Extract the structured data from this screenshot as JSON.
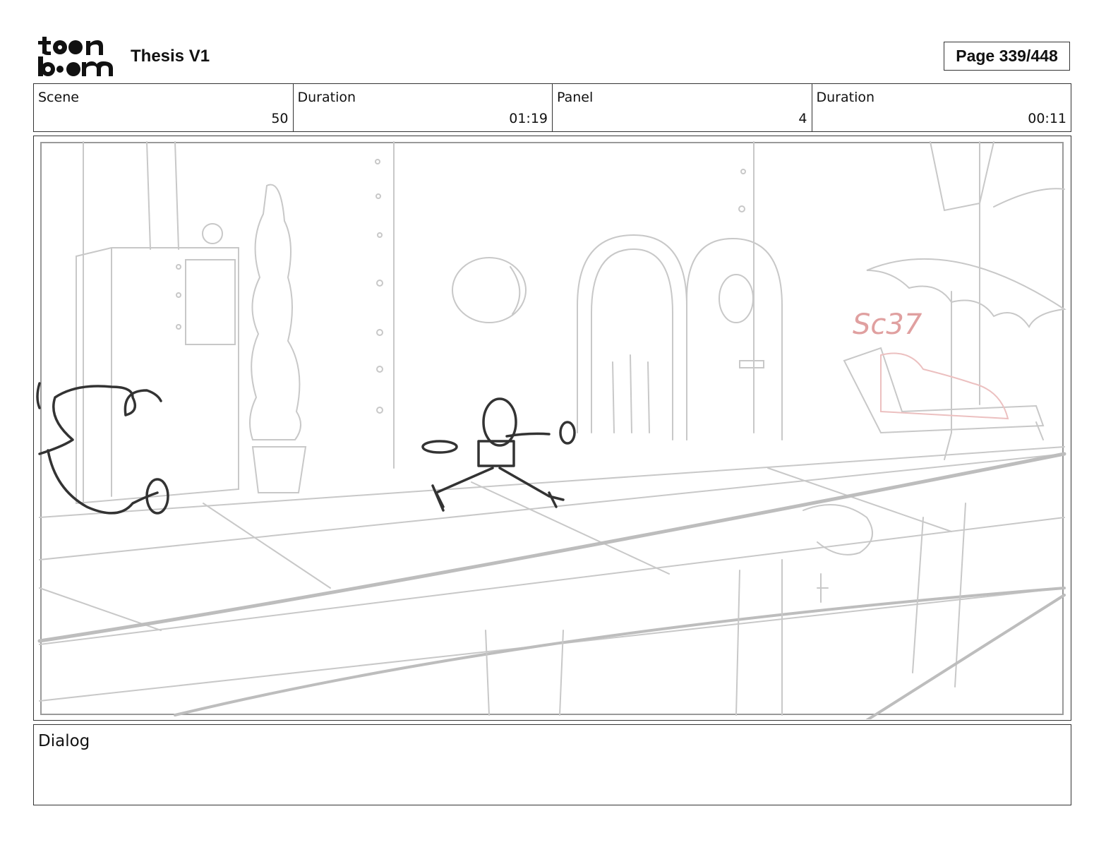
{
  "header": {
    "logo_text": "toon boom",
    "project_title": "Thesis V1",
    "page_indicator": "Page 339/448"
  },
  "info": {
    "scene_label": "Scene",
    "scene_value": "50",
    "scene_duration_label": "Duration",
    "scene_duration_value": "01:19",
    "panel_label": "Panel",
    "panel_value": "4",
    "panel_duration_label": "Duration",
    "panel_duration_value": "00:11"
  },
  "panel": {
    "sketch_note": "Sc37",
    "note_color": "#e0a0a0"
  },
  "dialog": {
    "label": "Dialog",
    "text": ""
  }
}
